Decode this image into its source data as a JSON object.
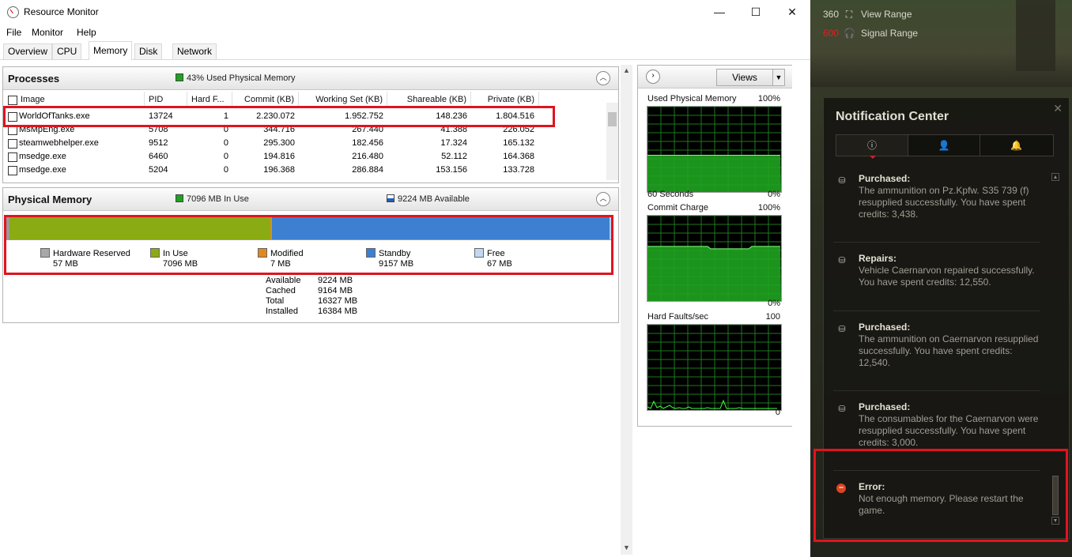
{
  "window": {
    "title": "Resource Monitor",
    "min": "—",
    "max": "☐",
    "close": "✕"
  },
  "menu": [
    "File",
    "Monitor",
    "Help"
  ],
  "tabs": [
    "Overview",
    "CPU",
    "Memory",
    "Disk",
    "Network"
  ],
  "processes": {
    "title": "Processes",
    "info": "43% Used Physical Memory",
    "columns": [
      "Image",
      "PID",
      "Hard F...",
      "Commit (KB)",
      "Working Set (KB)",
      "Shareable (KB)",
      "Private (KB)"
    ],
    "rows": [
      {
        "image": "WorldOfTanks.exe",
        "pid": "13724",
        "hf": "1",
        "commit": "2.230.072",
        "ws": "1.952.752",
        "share": "148.236",
        "priv": "1.804.516"
      },
      {
        "image": "MsMpEng.exe",
        "pid": "5708",
        "hf": "0",
        "commit": "344.716",
        "ws": "267.440",
        "share": "41.388",
        "priv": "226.052"
      },
      {
        "image": "steamwebhelper.exe",
        "pid": "9512",
        "hf": "0",
        "commit": "295.300",
        "ws": "182.456",
        "share": "17.324",
        "priv": "165.132"
      },
      {
        "image": "msedge.exe",
        "pid": "6460",
        "hf": "0",
        "commit": "194.816",
        "ws": "216.480",
        "share": "52.112",
        "priv": "164.368"
      },
      {
        "image": "msedge.exe",
        "pid": "5204",
        "hf": "0",
        "commit": "196.368",
        "ws": "286.884",
        "share": "153.156",
        "priv": "133.728"
      }
    ]
  },
  "physical_memory": {
    "title": "Physical Memory",
    "in_use_info": "7096 MB In Use",
    "available_info": "9224 MB Available",
    "band": [
      {
        "name": "Hardware Reserved",
        "mb": 57,
        "color": "#9a9a9a"
      },
      {
        "name": "In Use",
        "mb": 7096,
        "color": "#8aab14"
      },
      {
        "name": "Modified",
        "mb": 7,
        "color": "#e08a1e"
      },
      {
        "name": "Standby",
        "mb": 9157,
        "color": "#3d7fd0"
      },
      {
        "name": "Free",
        "mb": 67,
        "color": "#b9d2f0"
      }
    ],
    "legend": [
      {
        "label": "Hardware Reserved",
        "value": "57 MB",
        "color": "#a8a8a8"
      },
      {
        "label": "In Use",
        "value": "7096 MB",
        "color": "#8aab14"
      },
      {
        "label": "Modified",
        "value": "7 MB",
        "color": "#e08a1e"
      },
      {
        "label": "Standby",
        "value": "9157 MB",
        "color": "#3d7fd0"
      },
      {
        "label": "Free",
        "value": "67 MB",
        "color": "#c2d8f2"
      }
    ],
    "stats": [
      {
        "label": "Available",
        "value": "9224 MB"
      },
      {
        "label": "Cached",
        "value": "9164 MB"
      },
      {
        "label": "Total",
        "value": "16327 MB"
      },
      {
        "label": "Installed",
        "value": "16384 MB"
      }
    ]
  },
  "graphs": {
    "views_label": "Views",
    "used_physical": {
      "title": "Used Physical Memory",
      "max": "100%",
      "min": "0%",
      "footer": "60 Seconds",
      "level_pct": 43
    },
    "commit": {
      "title": "Commit Charge",
      "max": "100%",
      "min": "0%",
      "level_pct": 64
    },
    "hard_faults": {
      "title": "Hard Faults/sec",
      "max": "100",
      "min": "0"
    }
  },
  "hud": {
    "view_range_value": "360",
    "view_range_label": "View Range",
    "signal_range_value": "600",
    "signal_range_label": "Signal Range"
  },
  "notification_center": {
    "title": "Notification Center",
    "tabs": [
      {
        "icon": "info-icon",
        "glyph": "ⓘ"
      },
      {
        "icon": "contacts-icon",
        "glyph": "👤"
      },
      {
        "icon": "bell-icon",
        "glyph": "🔔"
      }
    ],
    "items": [
      {
        "title": "Purchased:",
        "body": "The ammunition on Pz.Kpfw. S35 739 (f) resupplied successfully. You have spent credits: 3,438.",
        "type": "purchase"
      },
      {
        "title": "Repairs:",
        "body": "Vehicle Caernarvon repaired successfully. You have spent credits: 12,550.",
        "type": "repair"
      },
      {
        "title": "Purchased:",
        "body": "The ammunition on Caernarvon resupplied successfully. You have spent credits: 12,540.",
        "type": "purchase"
      },
      {
        "title": "Purchased:",
        "body": "The consumables for the Caernarvon were resupplied successfully. You have spent credits: 3,000.",
        "type": "purchase"
      },
      {
        "title": "Error:",
        "body": "Not enough memory. Please restart the game.",
        "type": "error"
      }
    ]
  },
  "colors": {
    "highlight": "#e0141e",
    "graph_fill": "#1fa31f",
    "graph_grid": "#1d7a1d"
  }
}
